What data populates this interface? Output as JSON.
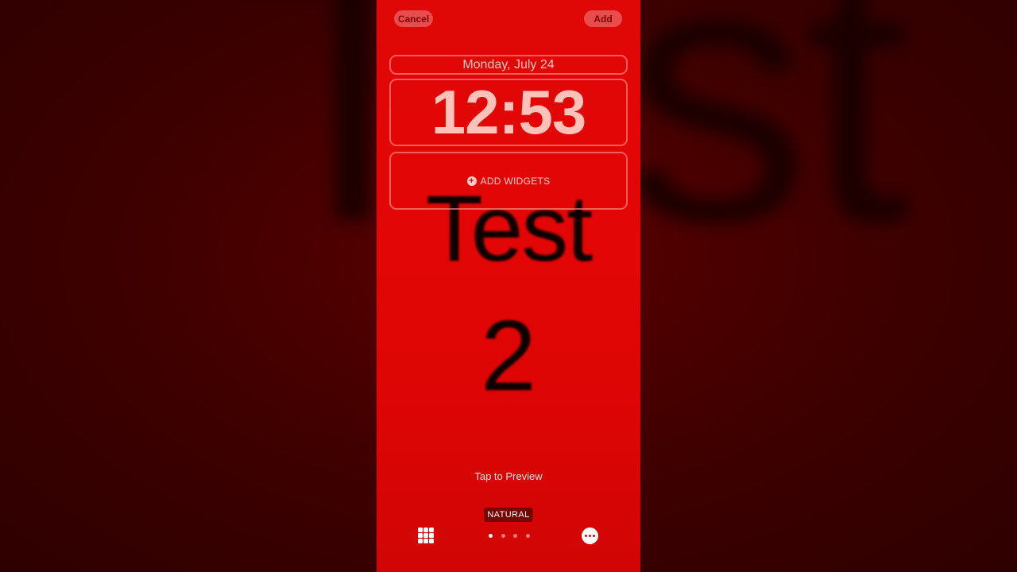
{
  "header": {
    "cancel_label": "Cancel",
    "add_label": "Add"
  },
  "lockscreen": {
    "date": "Monday, July 24",
    "time": "12:53",
    "add_widgets_label": "ADD WIDGETS"
  },
  "wallpaper": {
    "line1": "Test",
    "line2": "2",
    "background_text": "Test"
  },
  "footer": {
    "tap_to_preview": "Tap to Preview",
    "style_label": "NATURAL",
    "page_count": 4,
    "active_page": 1
  },
  "icons": {
    "grid": "photo-grid-icon",
    "more": "more-options-icon",
    "plus": "plus-circle-icon"
  },
  "colors": {
    "wallpaper_red": "#e00707",
    "backdrop": "#3a0000"
  }
}
